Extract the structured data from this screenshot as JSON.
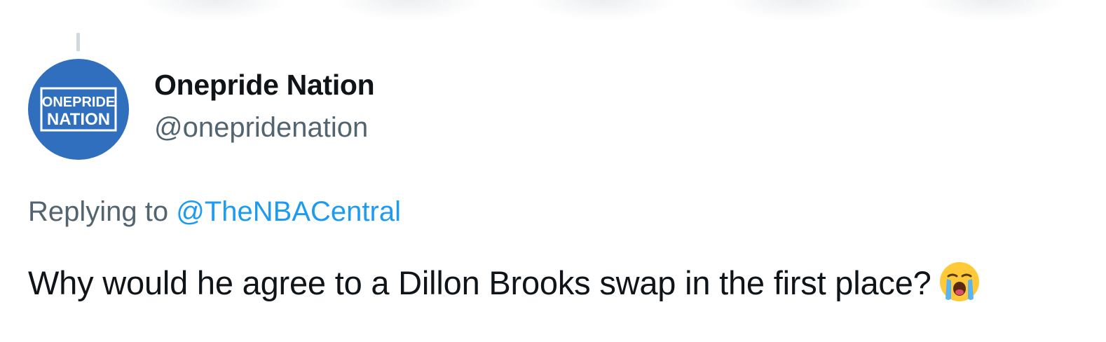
{
  "author": {
    "display_name": "Onepride Nation",
    "handle": "@onepridenation",
    "avatar": {
      "line1": "ONEPRIDE",
      "line2": "NATION",
      "background": "#2f6fbd"
    }
  },
  "reply": {
    "prefix": "Replying to ",
    "mention": "@TheNBACentral"
  },
  "tweet": {
    "text": "Why would he agree to a Dillon Brooks swap in the first place?",
    "emoji": "loudly-crying-face-icon"
  },
  "colors": {
    "text_primary": "#0f1419",
    "text_secondary": "#536471",
    "link": "#1d9bf0"
  }
}
